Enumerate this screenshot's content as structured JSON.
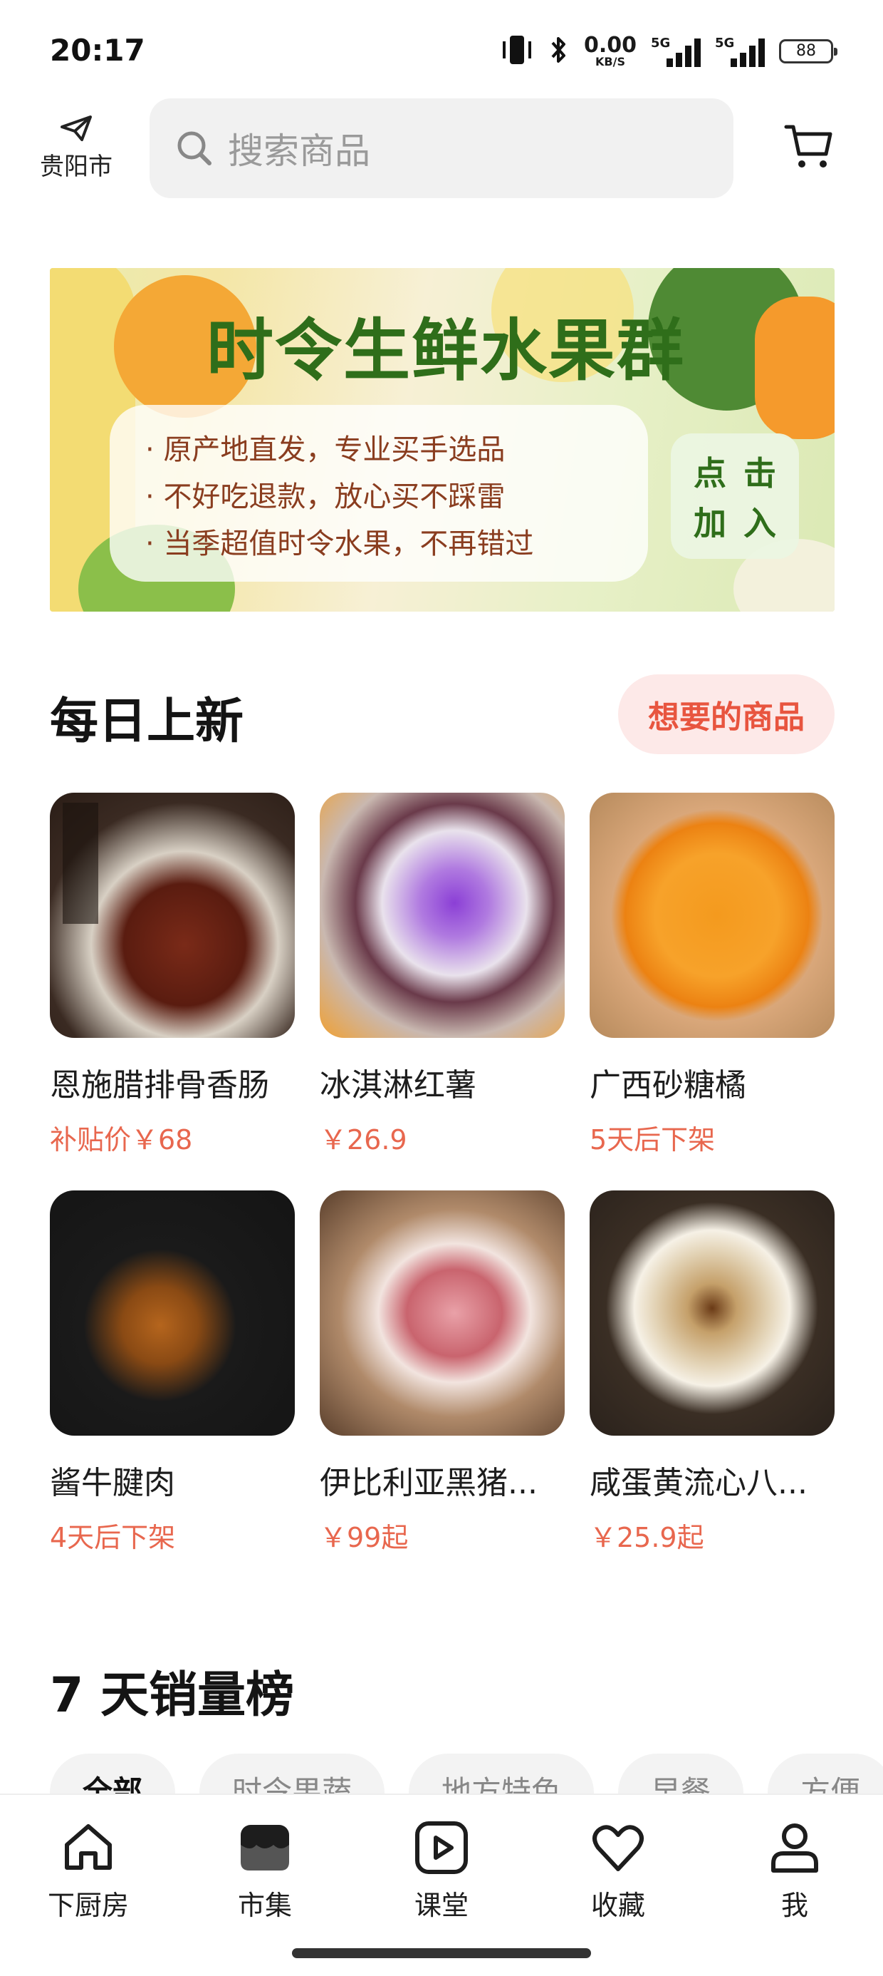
{
  "status_bar": {
    "time": "20:17",
    "net_speed": "0.00",
    "net_unit": "KB/S",
    "signal_1": "5G",
    "signal_2": "5G",
    "battery": "88",
    "icons": [
      "vibrate-icon",
      "bluetooth-icon",
      "signal-icon",
      "battery-icon"
    ]
  },
  "header": {
    "location": "贵阳市",
    "search_placeholder": "搜索商品",
    "icons": [
      "send-icon",
      "search-icon",
      "cart-icon"
    ]
  },
  "banner": {
    "title": "时令生鲜水果群",
    "bullets": [
      "原产地直发，专业买手选品",
      "不好吃退款，放心买不踩雷",
      "当季超值时令水果，不再错过"
    ],
    "button_chars": [
      "点",
      "击",
      "加",
      "入"
    ]
  },
  "daily": {
    "title": "每日上新",
    "want_button": "想要的商品",
    "products": [
      {
        "name": "恩施腊排骨香肠",
        "price": "补贴价￥68"
      },
      {
        "name": "冰淇淋红薯",
        "price": "￥26.9"
      },
      {
        "name": "广西砂糖橘",
        "price": "5天后下架"
      },
      {
        "name": "酱牛腱肉",
        "price": "4天后下架"
      },
      {
        "name": "伊比利亚黑猪...",
        "price": "￥99起"
      },
      {
        "name": "咸蛋黄流心八...",
        "price": "￥25.9起"
      }
    ]
  },
  "ranking": {
    "title": "7 天销量榜",
    "tabs": [
      "全部",
      "时令果蔬",
      "地方特色",
      "早餐",
      "方便"
    ]
  },
  "bottom_nav": {
    "items": [
      "下厨房",
      "市集",
      "课堂",
      "收藏",
      "我"
    ],
    "active": "市集"
  },
  "colors": {
    "accent": "#e8674e",
    "want_bg": "#fde9e8",
    "banner_green": "#2f6e1a"
  }
}
